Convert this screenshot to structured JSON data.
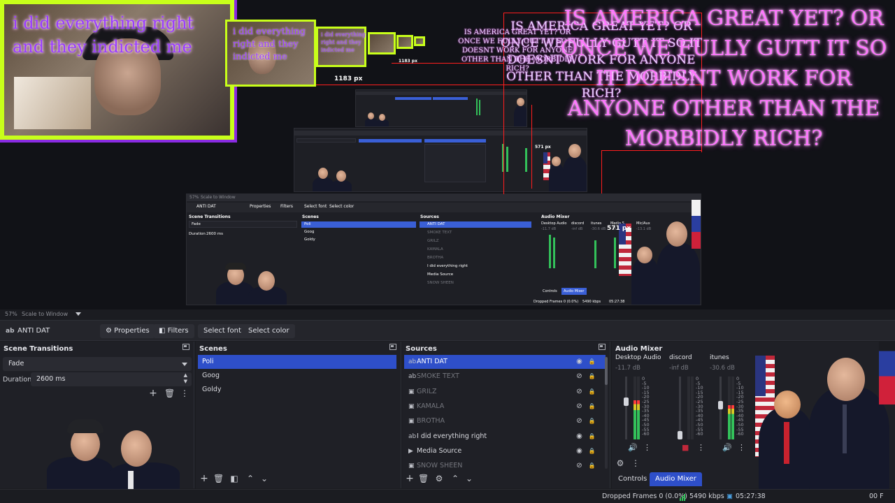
{
  "preview": {
    "webcam_text": "i did everything right and they indicted me",
    "mini_text_1": "i did everything right and they indicted me",
    "mini_text_2": "i did everything right and they indicted me",
    "px_tag_1": "1183 px",
    "px_tag_2": "571 px",
    "px_tag_3": "1183 px",
    "px_tag_4": "571 px",
    "overlay_text": "IS AMERICA GREAT YET? OR ONCE WE FULLY GUTT IT SO IT DOESNT WORK FOR ANYONE OTHER THAN THE MORBIDLY RICH?",
    "nested_toolbar": {
      "zoom": "57%",
      "scale_mode": "Scale to Window",
      "source": "ANTI DAT",
      "properties": "Properties",
      "filters": "Filters",
      "select_font": "Select font",
      "select_color": "Select color"
    },
    "nested_docks": {
      "transitions_title": "Scene Transitions",
      "transition": "Fade",
      "duration_label": "Duration",
      "duration": "2600 ms",
      "scenes_title": "Scenes",
      "scenes": [
        "Poli",
        "Goog",
        "Goldy"
      ],
      "sources_title": "Sources",
      "sources": [
        "ANTI DAT",
        "SMOKE TEXT",
        "GRILZ",
        "KAMALA",
        "BROTHA",
        "I did everything right",
        "Media Source",
        "SNOW SHEEN"
      ],
      "mixer_title": "Audio Mixer",
      "channels": [
        "Desktop Audio",
        "discord",
        "itunes",
        "Media S",
        "Mic/Aux"
      ],
      "dbs": [
        "-11.7 dB",
        "-inf dB",
        "-30.6 dB",
        "-13.3 dB",
        "-13.1 dB"
      ],
      "tab_controls": "Controls",
      "tab_mixer": "Audio Mixer",
      "dropped": "Dropped Frames 0 (0.0%)",
      "bitrate": "5490 kbps",
      "time": "05:27:38"
    }
  },
  "statusline": {
    "zoom": "57%",
    "scale_mode": "Scale to Window"
  },
  "toolbar": {
    "source_name": "ANTI DAT",
    "properties": "Properties",
    "filters": "Filters",
    "select_font": "Select font",
    "select_color": "Select color"
  },
  "transitions": {
    "title": "Scene Transitions",
    "value": "Fade",
    "duration_label": "Duration",
    "duration": "2600 ms"
  },
  "scenes": {
    "title": "Scenes",
    "items": [
      "Poli",
      "Goog",
      "Goldy"
    ]
  },
  "sources": {
    "title": "Sources",
    "items": [
      {
        "label": "ANTI DAT",
        "icon": "text-icon",
        "visible": true
      },
      {
        "label": "SMOKE TEXT",
        "icon": "text-icon",
        "visible": false
      },
      {
        "label": "GRILZ",
        "icon": "image-icon",
        "visible": false
      },
      {
        "label": "KAMALA",
        "icon": "image-icon",
        "visible": false
      },
      {
        "label": "BROTHA",
        "icon": "image-icon",
        "visible": false
      },
      {
        "label": "I did everything right",
        "icon": "text-icon",
        "visible": true
      },
      {
        "label": "Media Source",
        "icon": "play-icon",
        "visible": true
      },
      {
        "label": "SNOW SHEEN",
        "icon": "image-icon",
        "visible": false
      }
    ]
  },
  "mixer": {
    "title": "Audio Mixer",
    "channels": [
      {
        "name": "Desktop Audio",
        "db": "-11.7 dB",
        "level": 0.62
      },
      {
        "name": "discord",
        "db": "-inf dB",
        "level": 0.0
      },
      {
        "name": "itunes",
        "db": "-30.6 dB",
        "level": 0.55
      },
      {
        "name": "Media Source",
        "db": "-13.3 dB",
        "level": 0.6
      },
      {
        "name": "Mic/Aux",
        "db": "-13.1 dB",
        "level": 0.58
      }
    ],
    "scale": [
      "0",
      "-5",
      "-10",
      "-15",
      "-20",
      "-25",
      "-30",
      "-35",
      "-40",
      "-45",
      "-50",
      "-55",
      "-60"
    ],
    "tab_controls": "Controls",
    "tab_mixer": "Audio Mixer"
  },
  "statusbar": {
    "dropped": "Dropped Frames 0 (0.0%)",
    "bitrate": "5490 kbps",
    "time": "05:27:38",
    "fps_partial": "00 F"
  },
  "colors": {
    "accent": "#2e4fc9",
    "meter_green": "#33c15a",
    "meter_yellow": "#d7c825",
    "meter_red": "#ff3b3b",
    "overlay_pink": "#ff76ff",
    "webcam_border": "#c8ff1a"
  }
}
